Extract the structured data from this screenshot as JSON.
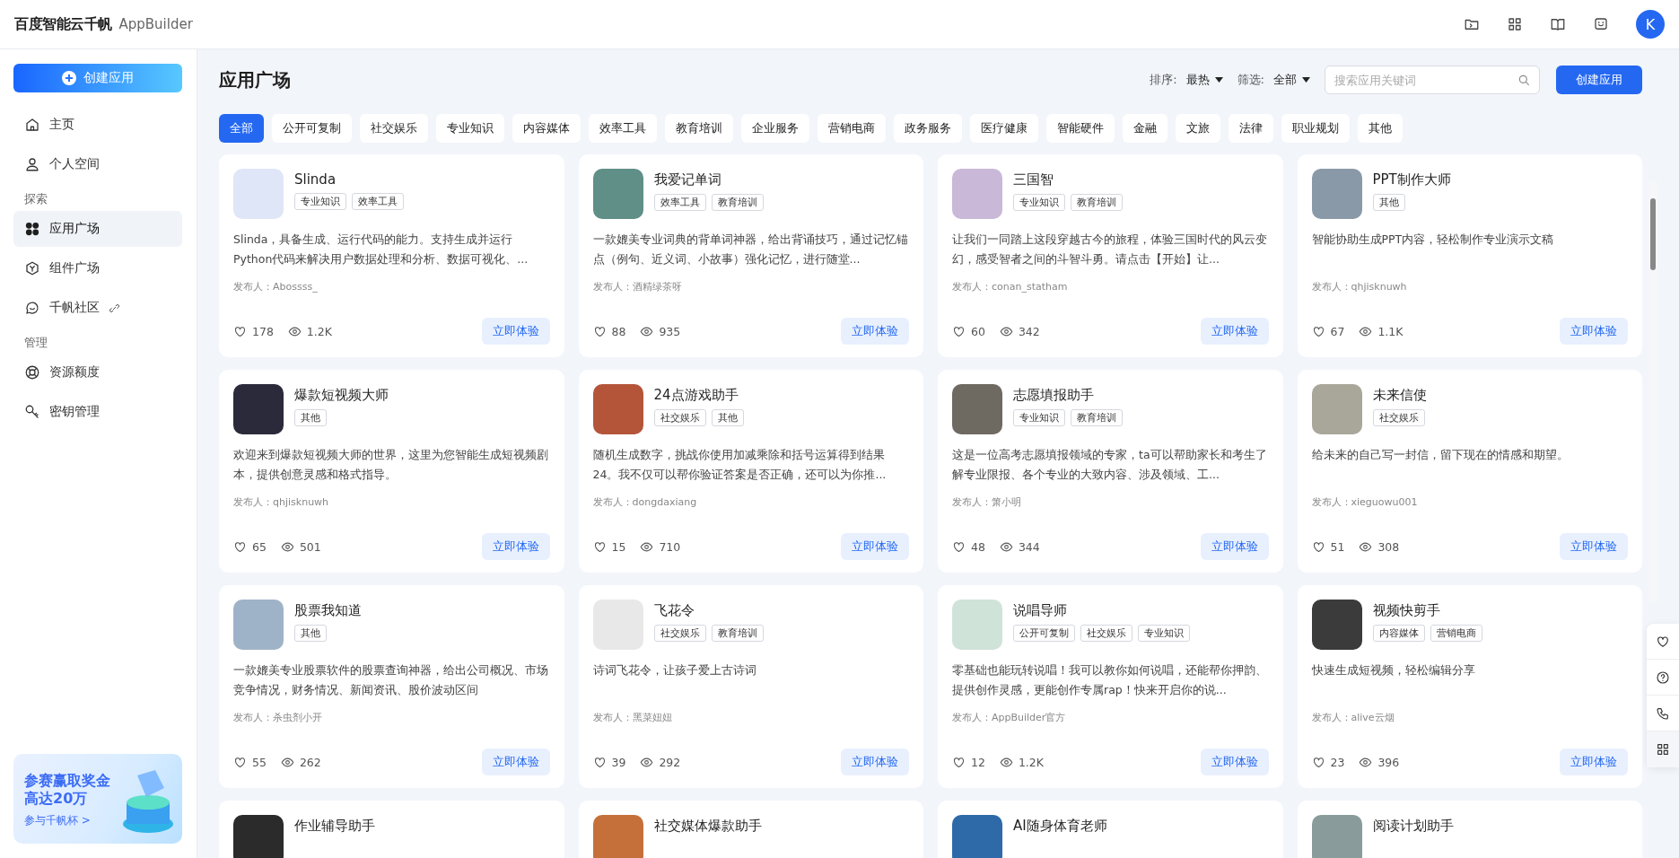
{
  "topbar": {
    "logo": "百度智能云千帆",
    "product": "AppBuilder",
    "avatar": "K"
  },
  "sidebar": {
    "create_button": "创建应用",
    "groups": [
      {
        "items": [
          {
            "label": "主页",
            "selected": false
          },
          {
            "label": "个人空间",
            "selected": false
          }
        ]
      },
      {
        "title": "探索",
        "items": [
          {
            "label": "应用广场",
            "selected": true
          },
          {
            "label": "组件广场",
            "selected": false
          },
          {
            "label": "千帆社区",
            "selected": false,
            "external": true
          }
        ]
      },
      {
        "title": "管理",
        "items": [
          {
            "label": "资源额度",
            "selected": false
          },
          {
            "label": "密钥管理",
            "selected": false
          }
        ]
      }
    ],
    "promo": {
      "title_lines": [
        "参赛赢取奖金",
        "高达20万"
      ],
      "link": "参与千帆杯 >"
    }
  },
  "main": {
    "title": "应用广场",
    "sort_label": "排序:",
    "sort_value": "最热",
    "filter_label": "筛选:",
    "filter_value": "全部",
    "search": {
      "placeholder": "搜索应用关键词"
    },
    "create_button": "创建应用",
    "categories": [
      {
        "label": "全部",
        "selected": true
      },
      {
        "label": "公开可复制",
        "selected": false
      },
      {
        "label": "社交娱乐",
        "selected": false
      },
      {
        "label": "专业知识",
        "selected": false
      },
      {
        "label": "内容媒体",
        "selected": false
      },
      {
        "label": "效率工具",
        "selected": false
      },
      {
        "label": "教育培训",
        "selected": false
      },
      {
        "label": "企业服务",
        "selected": false
      },
      {
        "label": "营销电商",
        "selected": false
      },
      {
        "label": "政务服务",
        "selected": false
      },
      {
        "label": "医疗健康",
        "selected": false
      },
      {
        "label": "智能硬件",
        "selected": false
      },
      {
        "label": "金融",
        "selected": false
      },
      {
        "label": "文旅",
        "selected": false
      },
      {
        "label": "法律",
        "selected": false
      },
      {
        "label": "职业规划",
        "selected": false
      },
      {
        "label": "其他",
        "selected": false
      }
    ],
    "cards": [
      {
        "title": "Slinda",
        "tags": [
          "专业知识",
          "效率工具"
        ],
        "description": "Slinda，具备生成、运行代码的能力。支持生成并运行Python代码来解决用户数据处理和分析、数据可视化、...",
        "publisher": "发布人：Abossss_",
        "likes": "178",
        "views": "1.2K",
        "button": "立即体验"
      },
      {
        "title": "我爱记单词",
        "tags": [
          "效率工具",
          "教育培训"
        ],
        "description": "一款媲美专业词典的背单词神器，给出背诵技巧，通过记忆锚点（例句、近义词、小故事）强化记忆，进行随堂...",
        "publisher": "发布人：酒精绿茶呀",
        "likes": "88",
        "views": "935",
        "button": "立即体验"
      },
      {
        "title": "三国智",
        "tags": [
          "专业知识",
          "教育培训"
        ],
        "description": "让我们一同踏上这段穿越古今的旅程，体验三国时代的风云变幻，感受智者之间的斗智斗勇。请点击【开始】让...",
        "publisher": "发布人：conan_statham",
        "likes": "60",
        "views": "342",
        "button": "立即体验"
      },
      {
        "title": "PPT制作大师",
        "tags": [
          "其他"
        ],
        "description": "智能协助生成PPT内容，轻松制作专业演示文稿",
        "publisher": "发布人：qhjisknuwh",
        "likes": "67",
        "views": "1.1K",
        "button": "立即体验"
      },
      {
        "title": "爆款短视频大师",
        "tags": [
          "其他"
        ],
        "description": "欢迎来到爆款短视频大师的世界，这里为您智能生成短视频剧本，提供创意灵感和格式指导。",
        "publisher": "发布人：qhjisknuwh",
        "likes": "65",
        "views": "501",
        "button": "立即体验"
      },
      {
        "title": "24点游戏助手",
        "tags": [
          "社交娱乐",
          "其他"
        ],
        "description": "随机生成数字，挑战你使用加减乘除和括号运算得到结果24。我不仅可以帮你验证答案是否正确，还可以为你推...",
        "publisher": "发布人：dongdaxiang",
        "likes": "15",
        "views": "710",
        "button": "立即体验"
      },
      {
        "title": "志愿填报助手",
        "tags": [
          "专业知识",
          "教育培训"
        ],
        "description": "这是一位高考志愿填报领域的专家，ta可以帮助家长和考生了解专业限报、各个专业的大致内容、涉及领域、工...",
        "publisher": "发布人：箫小明",
        "likes": "48",
        "views": "344",
        "button": "立即体验"
      },
      {
        "title": "未来信使",
        "tags": [
          "社交娱乐"
        ],
        "description": "给未来的自己写一封信，留下现在的情感和期望。",
        "publisher": "发布人：xieguowu001",
        "likes": "51",
        "views": "308",
        "button": "立即体验"
      },
      {
        "title": "股票我知道",
        "tags": [
          "其他"
        ],
        "description": "一款媲美专业股票软件的股票查询神器，给出公司概况、市场竞争情况，财务情况、新闻资讯、股价波动区间",
        "publisher": "发布人：杀虫剂小开",
        "likes": "55",
        "views": "262",
        "button": "立即体验"
      },
      {
        "title": "飞花令",
        "tags": [
          "社交娱乐",
          "教育培训"
        ],
        "description": "诗词飞花令，让孩子爱上古诗词",
        "publisher": "发布人：黑菜妞妞",
        "likes": "39",
        "views": "292",
        "button": "立即体验"
      },
      {
        "title": "说唱导师",
        "tags": [
          "公开可复制",
          "社交娱乐",
          "专业知识"
        ],
        "description": "零基础也能玩转说唱！我可以教你如何说唱，还能帮你押韵、提供创作灵感，更能创作专属rap！快来开启你的说...",
        "publisher": "发布人：AppBuilder官方",
        "likes": "12",
        "views": "1.2K",
        "button": "立即体验"
      },
      {
        "title": "视频快剪手",
        "tags": [
          "内容媒体",
          "营销电商"
        ],
        "description": "快速生成短视频，轻松编辑分享",
        "publisher": "发布人：alive云烟",
        "likes": "23",
        "views": "396",
        "button": "立即体验"
      },
      {
        "title": "作业辅导助手"
      },
      {
        "title": "社交媒体爆款助手"
      },
      {
        "title": "AI随身体育老师"
      },
      {
        "title": "阅读计划助手"
      }
    ]
  }
}
